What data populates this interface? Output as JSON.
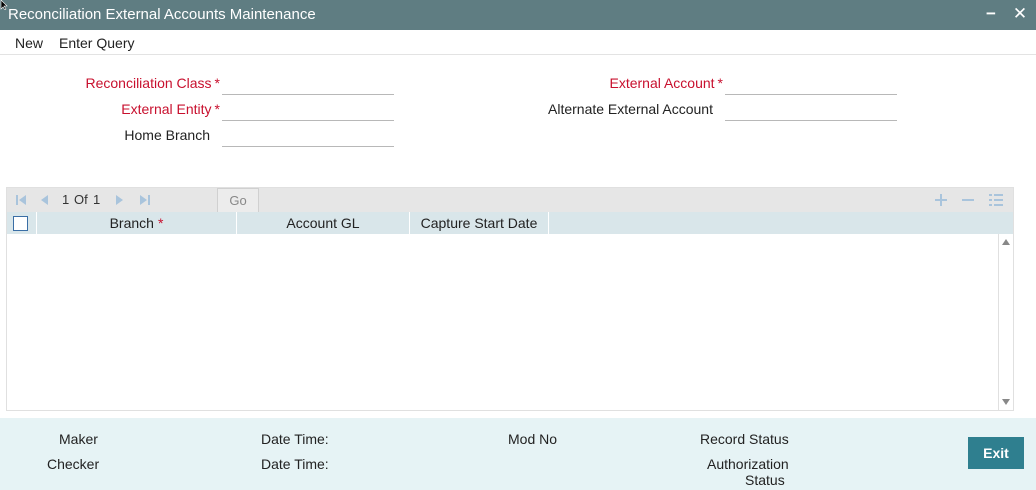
{
  "window": {
    "title": "Reconciliation External Accounts Maintenance",
    "minimize_label": "−",
    "close_label": "✕"
  },
  "menu": {
    "items": [
      "New",
      "Enter Query"
    ]
  },
  "form": {
    "reconciliation_class": {
      "label": "Reconciliation Class",
      "required": true,
      "value": ""
    },
    "external_entity": {
      "label": "External Entity",
      "required": true,
      "value": ""
    },
    "home_branch": {
      "label": "Home Branch",
      "required": false,
      "value": ""
    },
    "external_account": {
      "label": "External Account",
      "required": true,
      "value": ""
    },
    "alternate_external_account": {
      "label": "Alternate External Account",
      "required": false,
      "value": ""
    },
    "required_marker": "*"
  },
  "grid": {
    "pagination": {
      "current": "1",
      "of_label": "Of",
      "total": "1"
    },
    "go_label": "Go",
    "columns": [
      {
        "label": "Branch",
        "required": true
      },
      {
        "label": "Account GL",
        "required": false
      },
      {
        "label": "Capture Start Date",
        "required": false
      }
    ],
    "rows": []
  },
  "footer": {
    "maker_label": "Maker",
    "checker_label": "Checker",
    "date_time_label": "Date Time:",
    "mod_no_label": "Mod No",
    "record_status_label": "Record Status",
    "authorization_status_label_1": "Authorization",
    "authorization_status_label_2": "Status",
    "exit_label": "Exit"
  },
  "colors": {
    "titlebar": "#5f7d82",
    "required": "#c8102e",
    "grid_header": "#d9e6ea",
    "footer": "#e6f3f5",
    "exit_button": "#2f7f8f"
  },
  "icons": [
    "first-page-icon",
    "previous-page-icon",
    "next-page-icon",
    "last-page-icon",
    "add-row-icon",
    "delete-row-icon",
    "single-view-icon",
    "scroll-up-icon",
    "scroll-down-icon"
  ]
}
